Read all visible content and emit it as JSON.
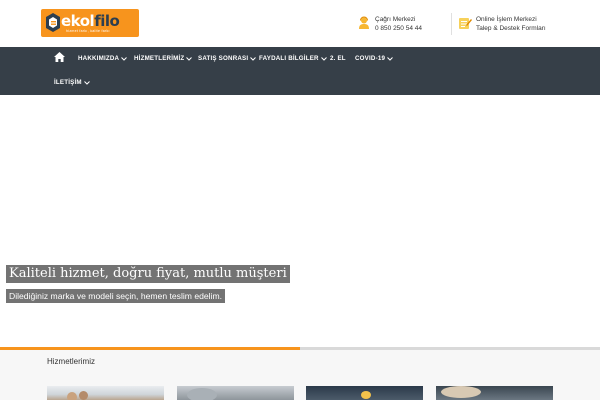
{
  "header": {
    "logo": {
      "brand_first": "ekol",
      "brand_second": "filo",
      "tagline": "hizmet farkı, kalite farkı"
    },
    "call_center": {
      "label": "Çağrı Merkezi",
      "phone": "0 850 250 54 44",
      "icon": "headset-user-icon"
    },
    "online": {
      "label": "Online İşlem Merkezi",
      "sub": "Talep & Destek Formları",
      "icon": "form-edit-icon"
    }
  },
  "nav": {
    "home_icon": "home-icon",
    "items": [
      {
        "label": "HAKKIMIZDA",
        "dropdown": true
      },
      {
        "label": "HİZMETLERİMİZ",
        "dropdown": true
      },
      {
        "label": "SATIŞ SONRASI",
        "dropdown": true
      },
      {
        "label": "FAYDALI BİLGİLER",
        "dropdown": true
      },
      {
        "label": "2. EL",
        "dropdown": false
      },
      {
        "label": "COVID-19",
        "dropdown": true
      },
      {
        "label": "İLETİŞİM",
        "dropdown": true
      }
    ]
  },
  "hero": {
    "title": "Kaliteli hizmet, doğru fiyat, mutlu müşteri",
    "subtitle": "Dilediğiniz marka ve modeli seçin, hemen teslim edelim."
  },
  "services": {
    "heading": "Hizmetlerimiz"
  },
  "colors": {
    "accent": "#f7941d",
    "navbar": "#363f48",
    "hero_caption_bg": "#5a5a5a"
  }
}
